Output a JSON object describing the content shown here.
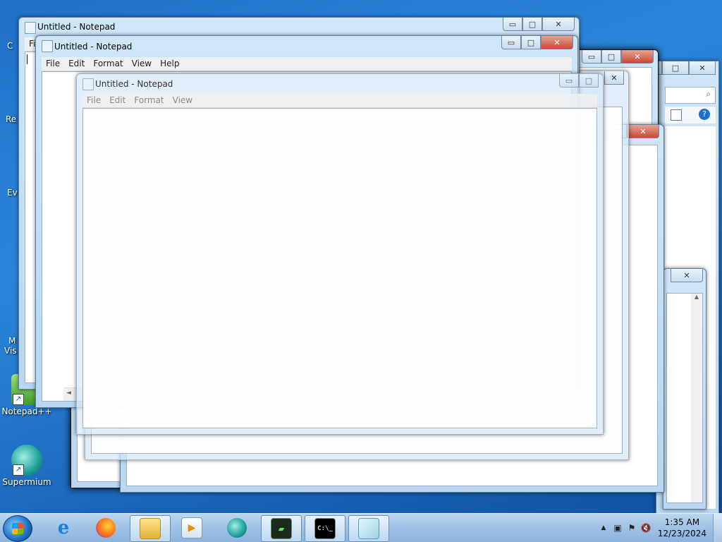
{
  "desktop": {
    "icons": [
      {
        "label": "Notepad++"
      },
      {
        "label": "Supermium"
      }
    ],
    "partial_labels": [
      "C",
      "Re",
      "Ev",
      "M",
      "Vis"
    ]
  },
  "windows": [
    {
      "title": "Untitled - Notepad",
      "menu": [
        "Fi"
      ]
    },
    {
      "title": "Untitled - Notepad",
      "menu": [
        "File",
        "Edit",
        "Format",
        "View",
        "Help"
      ]
    },
    {
      "title": "Untitled - Notepad",
      "menu": [
        "File",
        "Edit",
        "Format",
        "View"
      ]
    }
  ],
  "taskbar": {
    "clock_time": "1:35 AM",
    "clock_date": "12/23/2024",
    "items": [
      "internet-explorer",
      "firefox",
      "file-explorer",
      "media-player",
      "supermium",
      "task-manager",
      "command-prompt",
      "notepad"
    ]
  }
}
